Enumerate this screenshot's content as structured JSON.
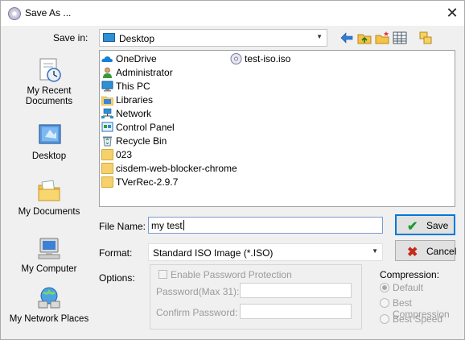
{
  "window": {
    "title": "Save As ...",
    "close_glyph": "✕"
  },
  "save_in": {
    "label": "Save in:",
    "value": "Desktop"
  },
  "places": [
    {
      "label": "My Recent Documents",
      "icon": "recent-documents-icon"
    },
    {
      "label": "Desktop",
      "icon": "desktop-icon"
    },
    {
      "label": "My Documents",
      "icon": "my-documents-icon"
    },
    {
      "label": "My Computer",
      "icon": "my-computer-icon"
    },
    {
      "label": "My Network Places",
      "icon": "network-places-icon"
    }
  ],
  "files": [
    {
      "name": "OneDrive",
      "icon": "onedrive-icon"
    },
    {
      "name": "Administrator",
      "icon": "user-icon"
    },
    {
      "name": "This PC",
      "icon": "this-pc-icon"
    },
    {
      "name": "Libraries",
      "icon": "libraries-icon"
    },
    {
      "name": "Network",
      "icon": "network-icon"
    },
    {
      "name": "Control Panel",
      "icon": "control-panel-icon"
    },
    {
      "name": "Recycle Bin",
      "icon": "recycle-bin-icon"
    },
    {
      "name": "023",
      "icon": "folder-icon"
    },
    {
      "name": "cisdem-web-blocker-chrome",
      "icon": "folder-icon"
    },
    {
      "name": "TVerRec-2.9.7",
      "icon": "folder-icon"
    },
    {
      "name": "test-iso.iso",
      "icon": "disc-icon"
    }
  ],
  "file_name": {
    "label": "File Name:",
    "value": "my test"
  },
  "format": {
    "label": "Format:",
    "value": "Standard ISO Image (*.ISO)"
  },
  "buttons": {
    "save": "Save",
    "cancel": "Cancel"
  },
  "options": {
    "label": "Options:",
    "enable_password": "Enable Password Protection",
    "password_label": "Password(Max 31):",
    "confirm_label": "Confirm Password:",
    "password_value": "",
    "confirm_value": ""
  },
  "compression": {
    "label": "Compression:",
    "options": [
      "Default",
      "Best Compression",
      "Best Speed"
    ],
    "selected": "Default"
  },
  "colors": {
    "accent": "#0078d7",
    "save_check": "#1f9a2c",
    "cancel_x": "#c42b1c"
  }
}
